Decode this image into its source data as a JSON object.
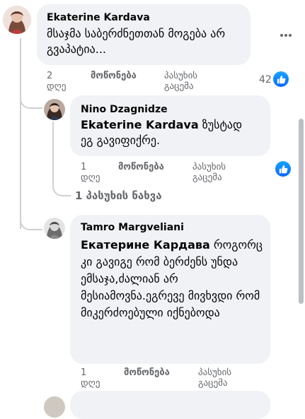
{
  "colors": {
    "bubble": "#f0f2f5",
    "meta_text": "#65676b",
    "thread_line": "#ced0d4",
    "like_blue": "#0866ff"
  },
  "comments": [
    {
      "author": "Ekaterine Kardava",
      "text": "მსაჯმა საბერძნეთთან მოგება არ გვაპატია...",
      "age_num": "2",
      "age_unit": "დღე",
      "like_label": "მოწონება",
      "reply_label_1": "პასუხის",
      "reply_label_2": "გაცემა",
      "reaction_count": "42",
      "more_icon": "more-dots-icon"
    },
    {
      "author": "Nino Dzagnidze",
      "mention": "Ekaterine Kardava",
      "text": "ზუსტად ეგ გავიფიქრე.",
      "age_num": "1",
      "age_unit": "დღე",
      "like_label": "მოწონება",
      "reply_label_1": "პასუხის",
      "reply_label_2": "გაცემა"
    },
    {
      "author": "Tamro Margveliani",
      "mention": "Екатерине Кардава",
      "text": "როგორც კი გავიგე რომ ბერძენს უნდა ემსაჯა,ძალიან არ მესიამოვნა.ეგრევე მივხვდი რომ მიკერძოებული იქნებოდა",
      "age_num": "1",
      "age_unit": "დღე",
      "like_label": "მოწონება",
      "reply_label_1": "პასუხის",
      "reply_label_2": "გაცემა"
    }
  ],
  "view_replies": "1 პასუხის ნახვა"
}
